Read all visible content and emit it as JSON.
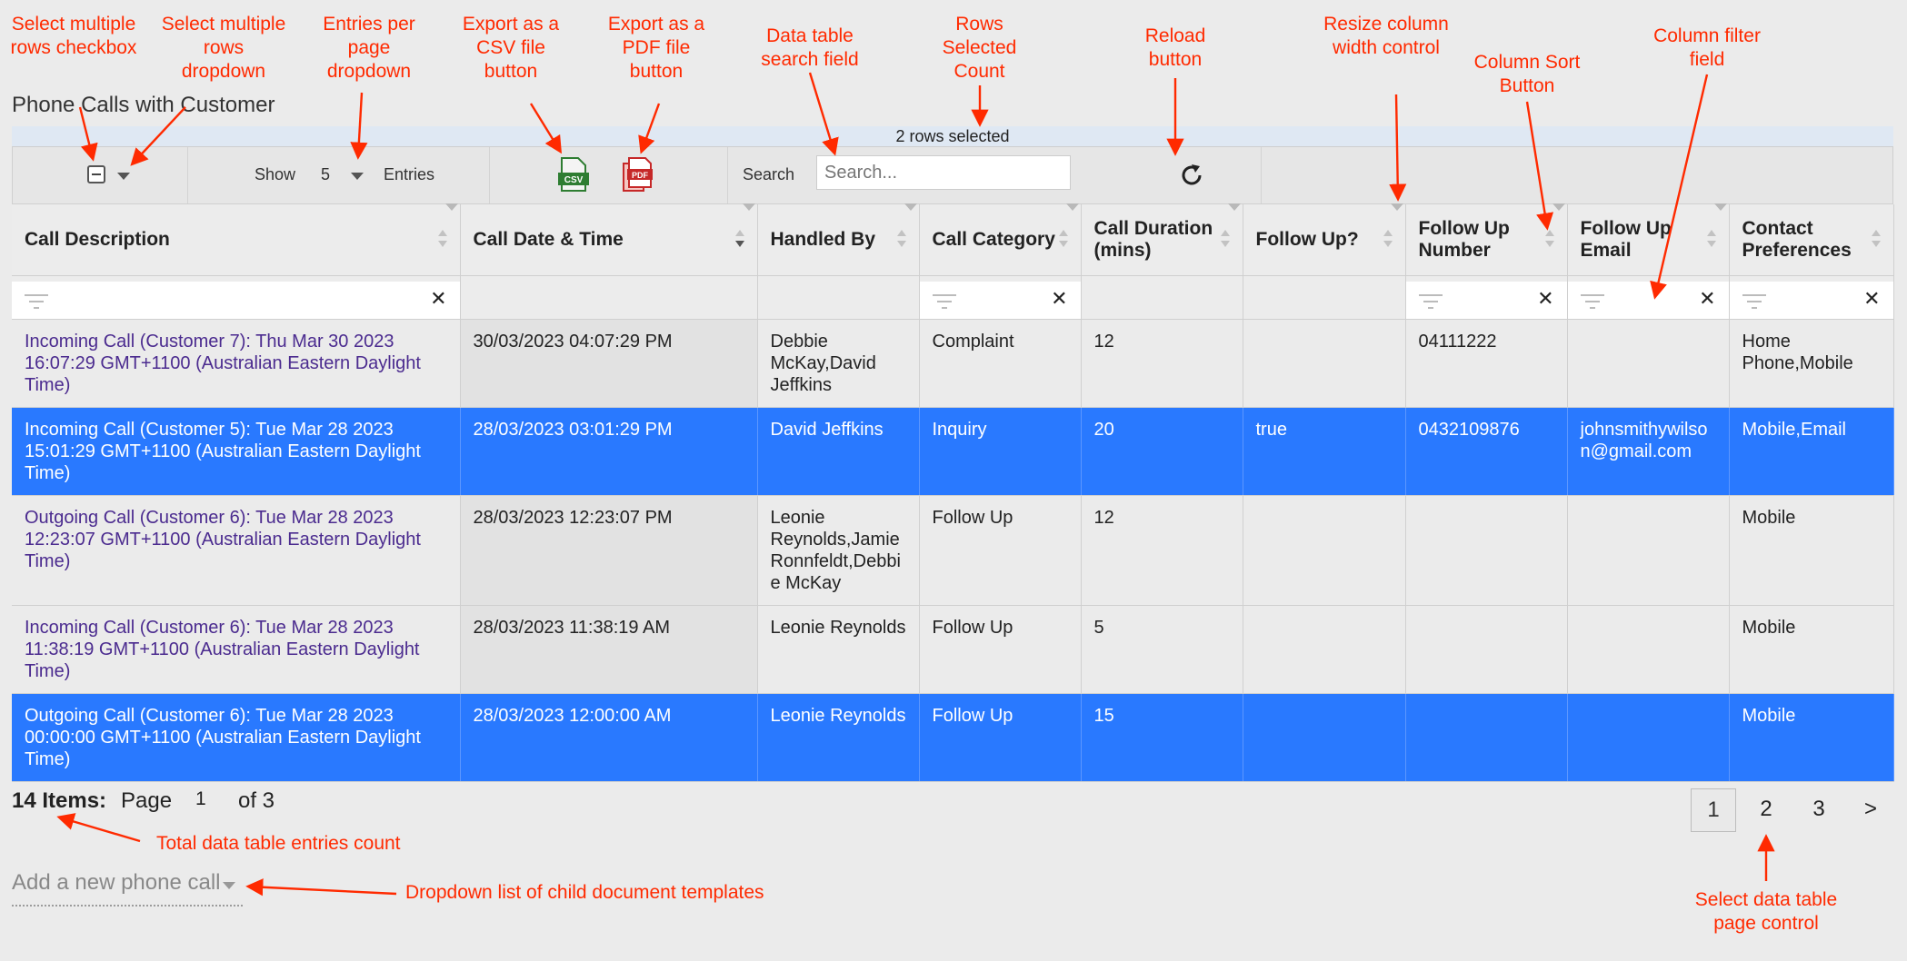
{
  "title": "Phone Calls with Customer",
  "selection": {
    "count_text": "2 rows selected"
  },
  "toolbar": {
    "show_label": "Show",
    "entries_value": "5",
    "entries_label": "Entries",
    "csv_label": "CSV",
    "pdf_label": "PDF",
    "search_label": "Search",
    "search_placeholder": "Search..."
  },
  "columns": [
    {
      "label": "Call Description"
    },
    {
      "label": "Call Date & Time"
    },
    {
      "label": "Handled By"
    },
    {
      "label": "Call Category"
    },
    {
      "label": "Call Duration (mins)"
    },
    {
      "label": "Follow Up?"
    },
    {
      "label": "Follow Up Number"
    },
    {
      "label": "Follow Up Email"
    },
    {
      "label": "Contact Preferences"
    }
  ],
  "rows": [
    {
      "selected": false,
      "cells": [
        "Incoming Call (Customer 7): Thu Mar 30 2023 16:07:29 GMT+1100 (Australian Eastern Daylight Time)",
        "30/03/2023 04:07:29 PM",
        "Debbie McKay,David Jeffkins",
        "Complaint",
        "12",
        "",
        "04111222",
        "",
        "Home Phone,Mobile"
      ]
    },
    {
      "selected": true,
      "cells": [
        "Incoming Call (Customer 5): Tue Mar 28 2023 15:01:29 GMT+1100 (Australian Eastern Daylight Time)",
        "28/03/2023 03:01:29 PM",
        "David Jeffkins",
        "Inquiry",
        "20",
        "true",
        "0432109876",
        "johnsmithywilson@gmail.com",
        "Mobile,Email"
      ]
    },
    {
      "selected": false,
      "cells": [
        "Outgoing Call (Customer 6): Tue Mar 28 2023 12:23:07 GMT+1100 (Australian Eastern Daylight Time)",
        "28/03/2023 12:23:07 PM",
        "Leonie Reynolds,Jamie Ronnfeldt,Debbie McKay",
        "Follow Up",
        "12",
        "",
        "",
        "",
        "Mobile"
      ]
    },
    {
      "selected": false,
      "cells": [
        "Incoming Call (Customer 6): Tue Mar 28 2023 11:38:19 GMT+1100 (Australian Eastern Daylight Time)",
        "28/03/2023 11:38:19 AM",
        "Leonie Reynolds",
        "Follow Up",
        "5",
        "",
        "",
        "",
        "Mobile"
      ]
    },
    {
      "selected": true,
      "cells": [
        "Outgoing Call (Customer 6): Tue Mar 28 2023 00:00:00 GMT+1100 (Australian Eastern Daylight Time)",
        "28/03/2023 12:00:00 AM",
        "Leonie Reynolds",
        "Follow Up",
        "15",
        "",
        "",
        "",
        "Mobile"
      ]
    }
  ],
  "footer": {
    "items": "14 Items:",
    "page_label": "Page",
    "page_value": "1",
    "of_label": "of 3",
    "pages": [
      "1",
      "2",
      "3",
      ">"
    ],
    "add_new": "Add a new phone call"
  },
  "annotations": {
    "select_checkbox": "Select multiple rows checkbox",
    "select_dropdown": "Select multiple rows dropdown",
    "entries_dropdown": "Entries per page dropdown",
    "export_csv": "Export as a CSV file button",
    "export_pdf": "Export as a PDF file button",
    "search_field": "Data table search field",
    "rows_selected": "Rows Selected Count",
    "reload": "Reload button",
    "resize": "Resize column width control",
    "sort": "Column Sort Button",
    "filter": "Column filter field",
    "total_count": "Total data table entries count",
    "child_templates": "Dropdown list of child document templates",
    "page_control": "Select data table page control"
  },
  "colors": {
    "selected_row": "#2979ff",
    "annotation": "#ff2a00",
    "link_text": "#4b2b8f"
  }
}
